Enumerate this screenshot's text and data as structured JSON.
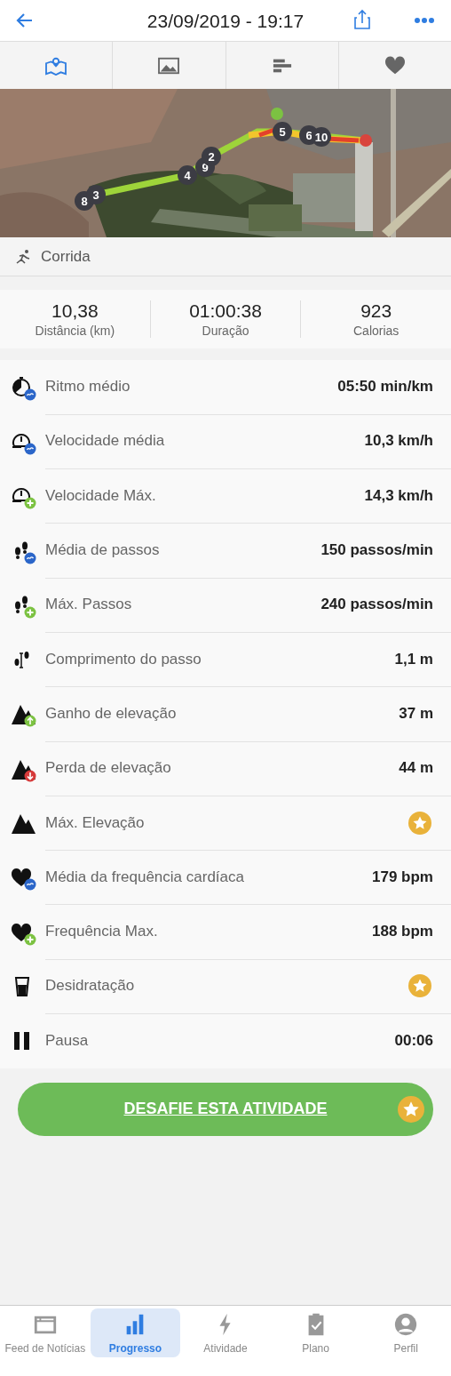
{
  "header": {
    "title": "23/09/2019 - 19:17"
  },
  "view_tabs": [
    {
      "selected": true
    },
    {
      "selected": false
    },
    {
      "selected": false
    },
    {
      "selected": false
    }
  ],
  "map": {
    "km_markers": [
      "8",
      "3",
      "4",
      "9",
      "2",
      "5",
      "6",
      "10"
    ]
  },
  "activity_type": "Corrida",
  "summary": [
    {
      "value": "10,38",
      "label": "Distância (km)"
    },
    {
      "value": "01:00:38",
      "label": "Duração"
    },
    {
      "value": "923",
      "label": "Calorias"
    }
  ],
  "metrics": [
    {
      "label": "Ritmo médio",
      "kind": "text",
      "value": "05:50 min/km"
    },
    {
      "label": "Velocidade média",
      "kind": "text",
      "value": "10,3 km/h"
    },
    {
      "label": "Velocidade Máx.",
      "kind": "text",
      "value": "14,3 km/h"
    },
    {
      "label": "Média de passos",
      "kind": "text",
      "value": "150 passos/min"
    },
    {
      "label": "Máx. Passos",
      "kind": "text",
      "value": "240 passos/min"
    },
    {
      "label": "Comprimento do passo",
      "kind": "text",
      "value": "1,1 m"
    },
    {
      "label": "Ganho de elevação",
      "kind": "text",
      "value": "37 m"
    },
    {
      "label": "Perda de elevação",
      "kind": "text",
      "value": "44 m"
    },
    {
      "label": "Máx. Elevação",
      "kind": "star"
    },
    {
      "label": "Média da frequência cardíaca",
      "kind": "text",
      "value": "179 bpm"
    },
    {
      "label": "Frequência Max.",
      "kind": "text",
      "value": "188 bpm"
    },
    {
      "label": "Desidratação",
      "kind": "star"
    },
    {
      "label": "Pausa",
      "kind": "text",
      "value": "00:06"
    }
  ],
  "challenge_button": {
    "label": "DESAFIE ESTA ATIVIDADE"
  },
  "bottom_nav": [
    {
      "label": "Feed de Notícias",
      "selected": false
    },
    {
      "label": "Progresso",
      "selected": true
    },
    {
      "label": "Atividade",
      "selected": false
    },
    {
      "label": "Plano",
      "selected": false
    },
    {
      "label": "Perfil",
      "selected": false
    }
  ]
}
